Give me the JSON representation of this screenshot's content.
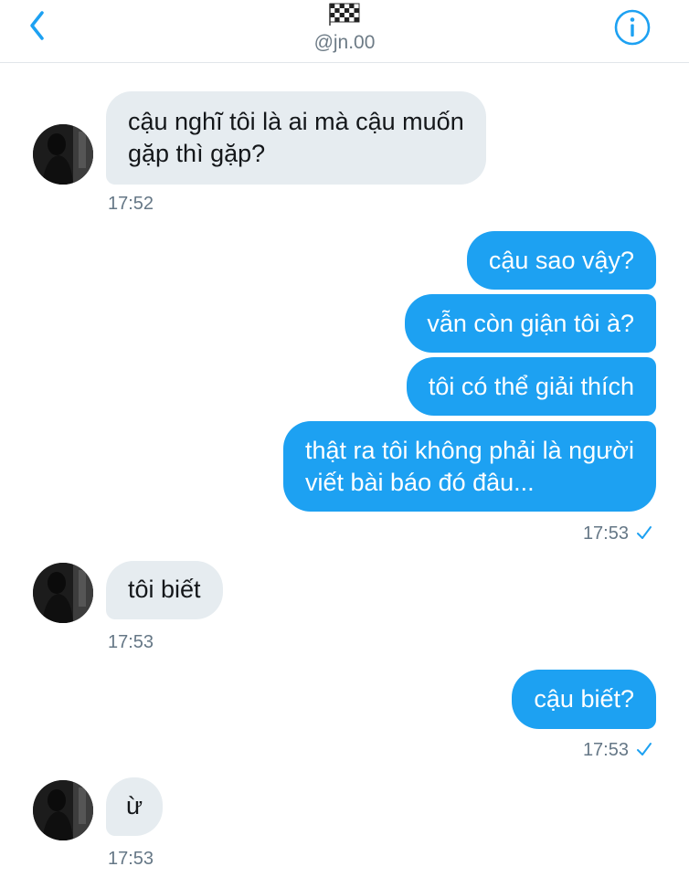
{
  "header": {
    "handle": "@jn.00",
    "back_icon": "chevron-left-icon",
    "flag_icon": "checkered-flag-icon",
    "info_icon": "info-icon"
  },
  "colors": {
    "accent": "#1da1f2",
    "incoming_bubble": "#e6ecf0",
    "timestamp": "#657786"
  },
  "messages": [
    {
      "direction": "incoming",
      "lines": [
        "cậu nghĩ tôi là ai mà cậu muốn",
        "gặp thì gặp?"
      ],
      "time": "17:52"
    },
    {
      "direction": "outgoing",
      "group": [
        {
          "lines": [
            "cậu sao vậy?"
          ]
        },
        {
          "lines": [
            "vẫn còn giận tôi à?"
          ]
        },
        {
          "lines": [
            "tôi có thể giải thích"
          ]
        },
        {
          "lines": [
            "thật ra tôi không phải là người",
            "viết bài báo đó đâu..."
          ]
        }
      ],
      "time": "17:53"
    },
    {
      "direction": "incoming",
      "lines": [
        "tôi biết"
      ],
      "time": "17:53"
    },
    {
      "direction": "outgoing",
      "group": [
        {
          "lines": [
            "cậu biết?"
          ]
        }
      ],
      "time": "17:53"
    },
    {
      "direction": "incoming",
      "lines": [
        "ừ"
      ],
      "time": "17:53"
    }
  ]
}
